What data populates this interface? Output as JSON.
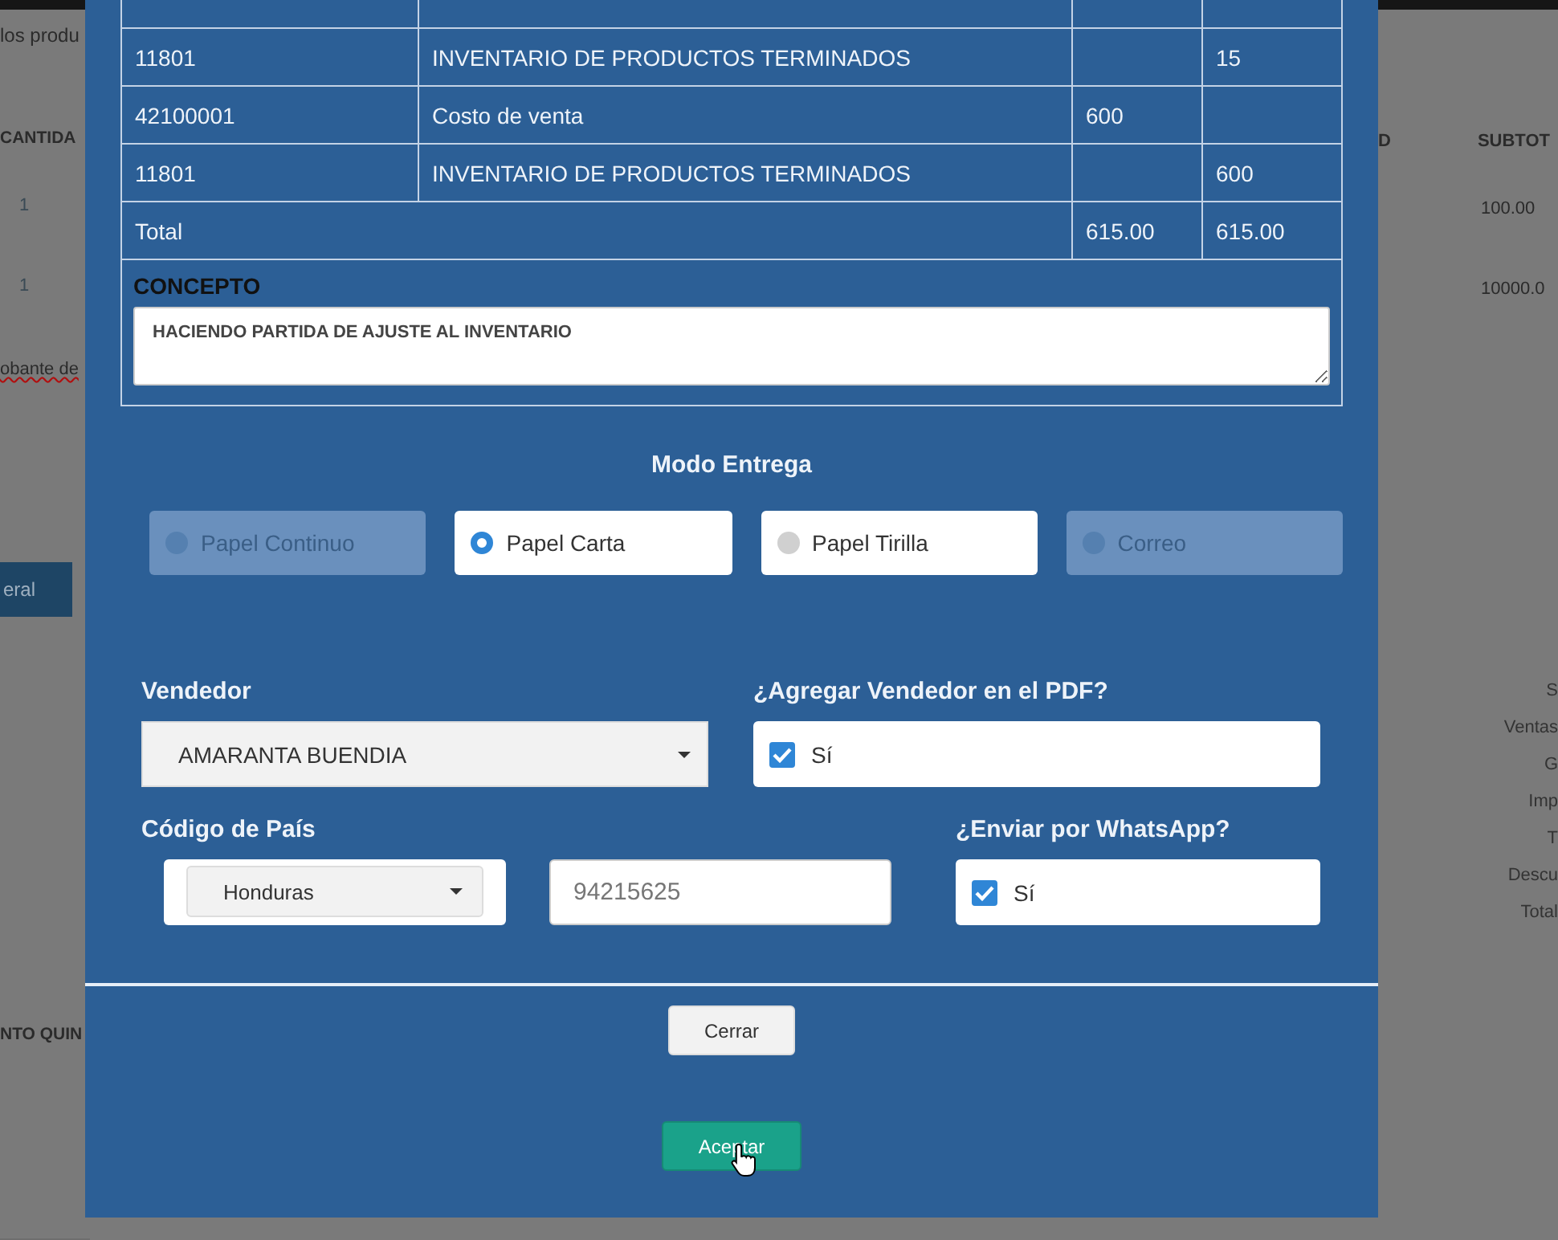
{
  "background": {
    "left": {
      "heading": "los produ",
      "column": "CANTIDA",
      "cells": [
        "1",
        "1"
      ],
      "note": "obante de",
      "button": "eral",
      "footer": "NTO QUIN"
    },
    "right": {
      "column": "D",
      "heading": "SUBTOT",
      "cells": [
        "100.00",
        "10000.0"
      ],
      "summary": [
        "S",
        "Ventas",
        "G",
        "Imp",
        "T",
        "Descu",
        "Total"
      ]
    }
  },
  "journal": {
    "rows": [
      {
        "account": "11801",
        "description": "INVENTARIO DE PRODUCTOS TERMINADOS",
        "credit": "15"
      },
      {
        "account": "42100001",
        "description": "Costo de venta",
        "debit": "600"
      },
      {
        "account": "11801",
        "description": "INVENTARIO DE PRODUCTOS TERMINADOS",
        "credit": "600"
      }
    ],
    "total": {
      "label": "Total",
      "debit": "615.00",
      "credit": "615.00"
    },
    "concept": {
      "label": "CONCEPTO",
      "value": "HACIENDO PARTIDA DE AJUSTE AL INVENTARIO"
    }
  },
  "delivery": {
    "title": "Modo Entrega",
    "options": [
      {
        "label": "Papel Continuo",
        "selected": false,
        "disabled": true
      },
      {
        "label": "Papel Carta",
        "selected": true,
        "disabled": false
      },
      {
        "label": "Papel Tirilla",
        "selected": false,
        "disabled": false
      },
      {
        "label": "Correo",
        "selected": false,
        "disabled": true
      }
    ]
  },
  "seller": {
    "label": "Vendedor",
    "value": "AMARANTA BUENDIA"
  },
  "add_seller_pdf": {
    "label": "¿Agregar Vendedor en el PDF?",
    "option": "Sí",
    "checked": true
  },
  "country": {
    "label": "Código de País",
    "value": "Honduras"
  },
  "phone": {
    "placeholder": "94215625"
  },
  "whatsapp": {
    "label": "¿Enviar por WhatsApp?",
    "option": "Sí",
    "checked": true
  },
  "buttons": [
    {
      "label": "Cerrar",
      "kind": "secondary"
    },
    {
      "label": "Aceptar",
      "kind": "primary"
    }
  ]
}
